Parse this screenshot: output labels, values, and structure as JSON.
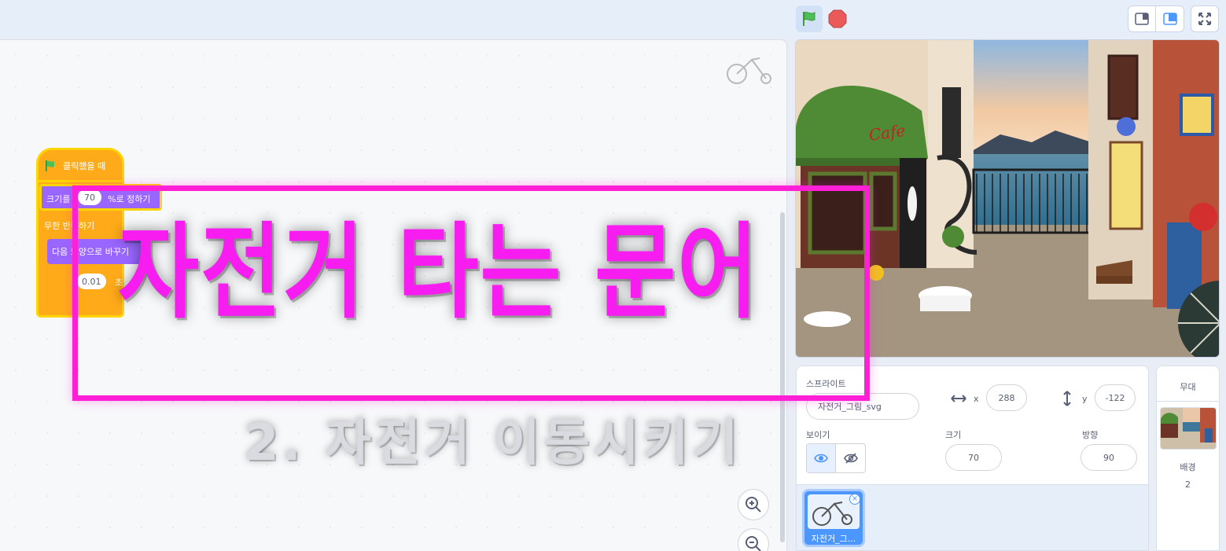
{
  "controls": {
    "green_flag": "green-flag-icon",
    "stop": "stop-icon",
    "layout_small": "small-stage-icon",
    "layout_normal": "normal-stage-icon",
    "fullscreen": "fullscreen-icon"
  },
  "blocks": {
    "hat_label": "클릭했을 때",
    "set_size_prefix": "크기를",
    "set_size_value": "70",
    "set_size_suffix": "%로 정하기",
    "forever_label": "무한 반복하기",
    "next_costume": "다음 모양으로 바꾸기",
    "wait_value": "0.01",
    "wait_suffix": "초 기"
  },
  "overlay": {
    "title": "자전거 타는 문어",
    "subtitle": "2. 자전거 이동시키기"
  },
  "sprite_info": {
    "sprite_label": "스프라이트",
    "sprite_name": "자전거_그림_svg",
    "x_label": "x",
    "x_value": "288",
    "y_label": "y",
    "y_value": "-122",
    "show_label": "보이기",
    "size_label": "크기",
    "size_value": "70",
    "direction_label": "방향",
    "direction_value": "90"
  },
  "sprite_list": {
    "tiles": [
      {
        "name": "자전거_그..."
      }
    ]
  },
  "stage_pane": {
    "title": "무대",
    "backdrop_label": "배경",
    "backdrop_count": "2"
  },
  "stage_scene": {
    "cafe_sign": "Cafe"
  },
  "colors": {
    "accent": "#4c97ff",
    "events": "#ffab19",
    "looks": "#9966ff",
    "highlight": "#ffd400",
    "caption_magenta": "#f71cf0"
  }
}
